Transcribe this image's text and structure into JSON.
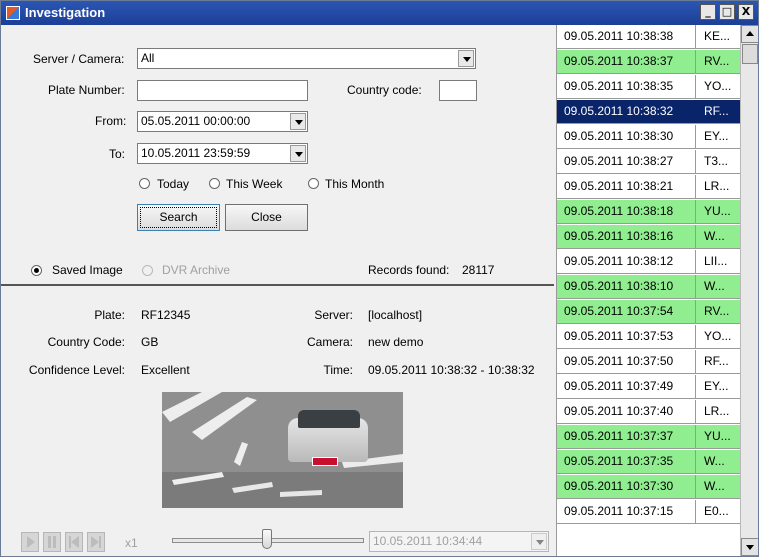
{
  "window": {
    "title": "Investigation",
    "controls": {
      "minimize": "_",
      "maximize": "□",
      "close": "X"
    }
  },
  "search": {
    "server_label": "Server / Camera:",
    "server_value": "All",
    "plate_label": "Plate Number:",
    "plate_value": "",
    "country_label": "Country code:",
    "country_value": "",
    "from_label": "From:",
    "from_value": "05.05.2011 00:00:00",
    "to_label": "To:",
    "to_value": "10.05.2011 23:59:59",
    "quick_ranges": [
      "Today",
      "This Week",
      "This Month"
    ],
    "search_button": "Search",
    "close_button": "Close"
  },
  "source": {
    "saved_image": "Saved Image",
    "dvr_archive": "DVR Archive",
    "records_found_label": "Records found:",
    "records_found_value": "28117"
  },
  "details": {
    "plate_label": "Plate:",
    "plate_value": "RF12345",
    "country_label": "Country Code:",
    "country_value": "GB",
    "confidence_label": "Confidence Level:",
    "confidence_value": "Excellent",
    "server_label": "Server:",
    "server_value": "[localhost]",
    "camera_label": "Camera:",
    "camera_value": "new demo",
    "time_label": "Time:",
    "time_value": "09.05.2011 10:38:32 - 10:38:32"
  },
  "player": {
    "speed": "x1",
    "position_time": "10.05.2011 10:34:44",
    "slider_fraction": 0.5
  },
  "results": [
    {
      "time": "09.05.2011 10:38:38",
      "plate": "KE...",
      "state": "normal"
    },
    {
      "time": "09.05.2011 10:38:37",
      "plate": "RV...",
      "state": "green"
    },
    {
      "time": "09.05.2011 10:38:35",
      "plate": "YO...",
      "state": "normal"
    },
    {
      "time": "09.05.2011 10:38:32",
      "plate": "RF...",
      "state": "selected"
    },
    {
      "time": "09.05.2011 10:38:30",
      "plate": "EY...",
      "state": "normal"
    },
    {
      "time": "09.05.2011 10:38:27",
      "plate": "T3...",
      "state": "normal"
    },
    {
      "time": "09.05.2011 10:38:21",
      "plate": "LR...",
      "state": "normal"
    },
    {
      "time": "09.05.2011 10:38:18",
      "plate": "YU...",
      "state": "green"
    },
    {
      "time": "09.05.2011 10:38:16",
      "plate": "W...",
      "state": "green"
    },
    {
      "time": "09.05.2011 10:38:12",
      "plate": "LII...",
      "state": "normal"
    },
    {
      "time": "09.05.2011 10:38:10",
      "plate": "W...",
      "state": "green"
    },
    {
      "time": "09.05.2011 10:37:54",
      "plate": "RV...",
      "state": "green"
    },
    {
      "time": "09.05.2011 10:37:53",
      "plate": "YO...",
      "state": "normal"
    },
    {
      "time": "09.05.2011 10:37:50",
      "plate": "RF...",
      "state": "normal"
    },
    {
      "time": "09.05.2011 10:37:49",
      "plate": "EY...",
      "state": "normal"
    },
    {
      "time": "09.05.2011 10:37:40",
      "plate": "LR...",
      "state": "normal"
    },
    {
      "time": "09.05.2011 10:37:37",
      "plate": "YU...",
      "state": "green"
    },
    {
      "time": "09.05.2011 10:37:35",
      "plate": "W...",
      "state": "green"
    },
    {
      "time": "09.05.2011 10:37:30",
      "plate": "W...",
      "state": "green"
    },
    {
      "time": "09.05.2011 10:37:15",
      "plate": "E0...",
      "state": "normal"
    }
  ],
  "colors": {
    "title_bar": "#1c3f97",
    "row_green": "#90ee90",
    "row_selected": "#0a246a"
  }
}
